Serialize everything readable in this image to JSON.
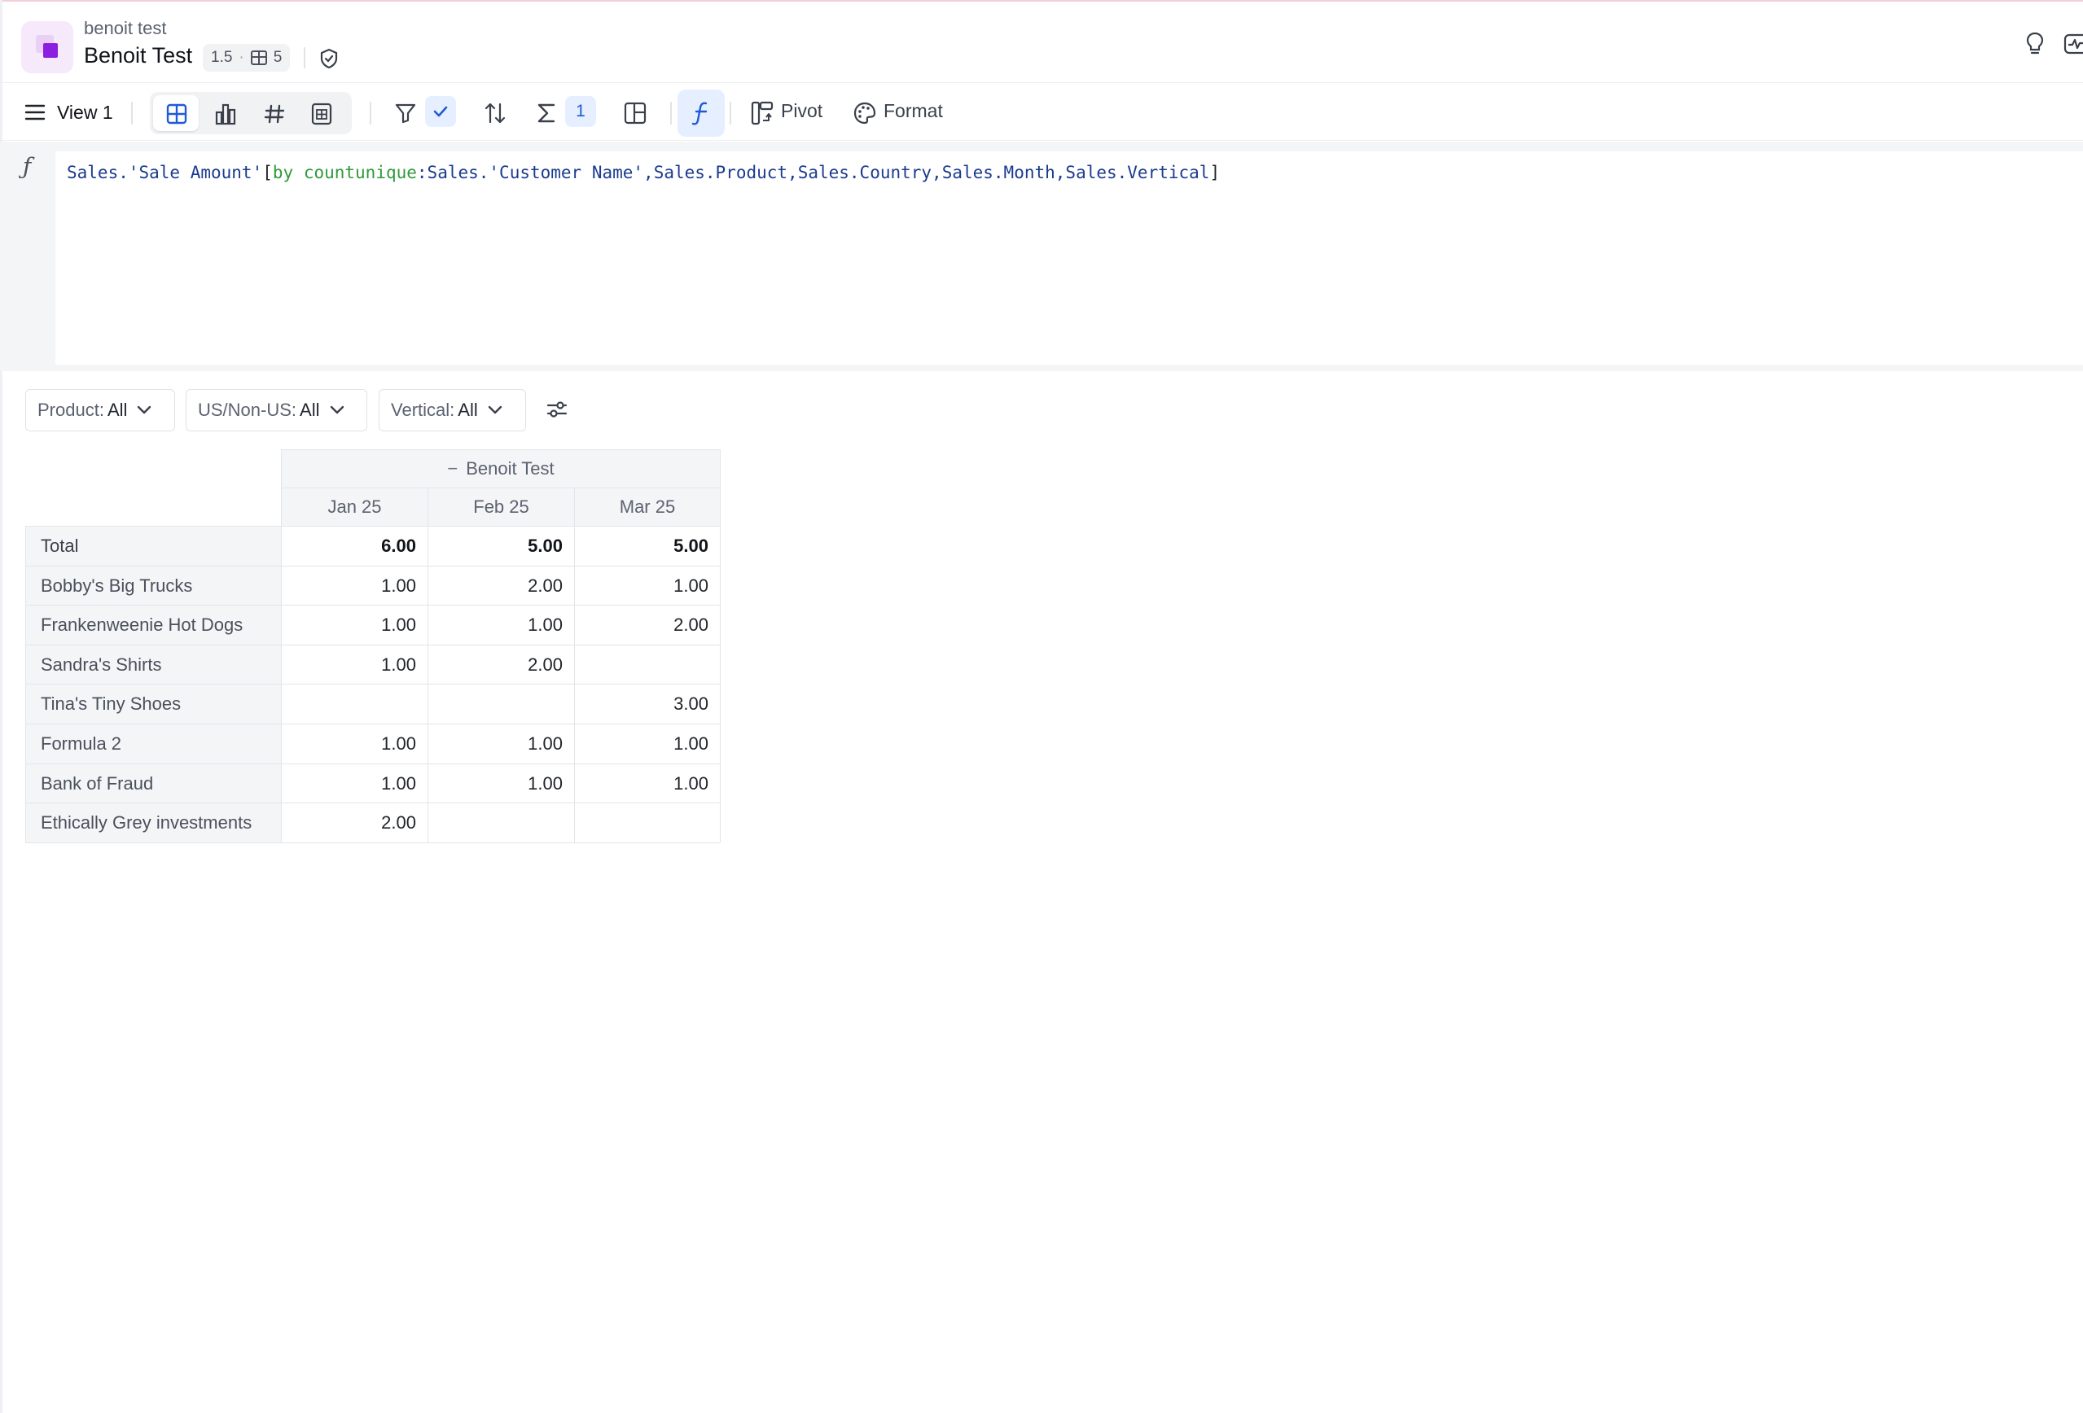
{
  "header": {
    "workbook_name": "benoit test",
    "page_title": "Benoit Test",
    "version": "1.5",
    "separator": "·",
    "table_count": "5"
  },
  "toolbar": {
    "view_label": "View 1",
    "summary_count": "1",
    "pivot_label": "Pivot",
    "format_label": "Format"
  },
  "formula": {
    "part1": "Sales.'Sale Amount'",
    "bracket_open": "[",
    "keyword_by": "by",
    "keyword_fn": "countunique",
    "part2": ":Sales.'Customer Name',Sales.Product,Sales.Country,Sales.Month,Sales.Vertical",
    "bracket_close": "]"
  },
  "filters": [
    {
      "label": "Product:",
      "value": "All"
    },
    {
      "label": "US/Non-US:",
      "value": "All"
    },
    {
      "label": "Vertical:",
      "value": "All"
    }
  ],
  "pivot": {
    "group_header": "Benoit Test",
    "collapse_glyph": "−",
    "columns": [
      "Jan 25",
      "Feb 25",
      "Mar 25"
    ],
    "rows": [
      {
        "label": "Total",
        "values": [
          "6.00",
          "5.00",
          "5.00"
        ]
      },
      {
        "label": "Bobby's Big Trucks",
        "values": [
          "1.00",
          "2.00",
          "1.00"
        ]
      },
      {
        "label": "Frankenweenie Hot Dogs",
        "values": [
          "1.00",
          "1.00",
          "2.00"
        ]
      },
      {
        "label": "Sandra's Shirts",
        "values": [
          "1.00",
          "2.00",
          ""
        ]
      },
      {
        "label": "Tina's Tiny Shoes",
        "values": [
          "",
          "",
          "3.00"
        ]
      },
      {
        "label": "Formula 2",
        "values": [
          "1.00",
          "1.00",
          "1.00"
        ]
      },
      {
        "label": "Bank of Fraud",
        "values": [
          "1.00",
          "1.00",
          "1.00"
        ]
      },
      {
        "label": "Ethically Grey investments",
        "values": [
          "2.00",
          "",
          ""
        ]
      }
    ]
  },
  "colors": {
    "accent": "#1f5bd6",
    "accent_bg": "#e6efff",
    "brand": "#8c1ee0",
    "keyword": "#2f9a3c"
  }
}
